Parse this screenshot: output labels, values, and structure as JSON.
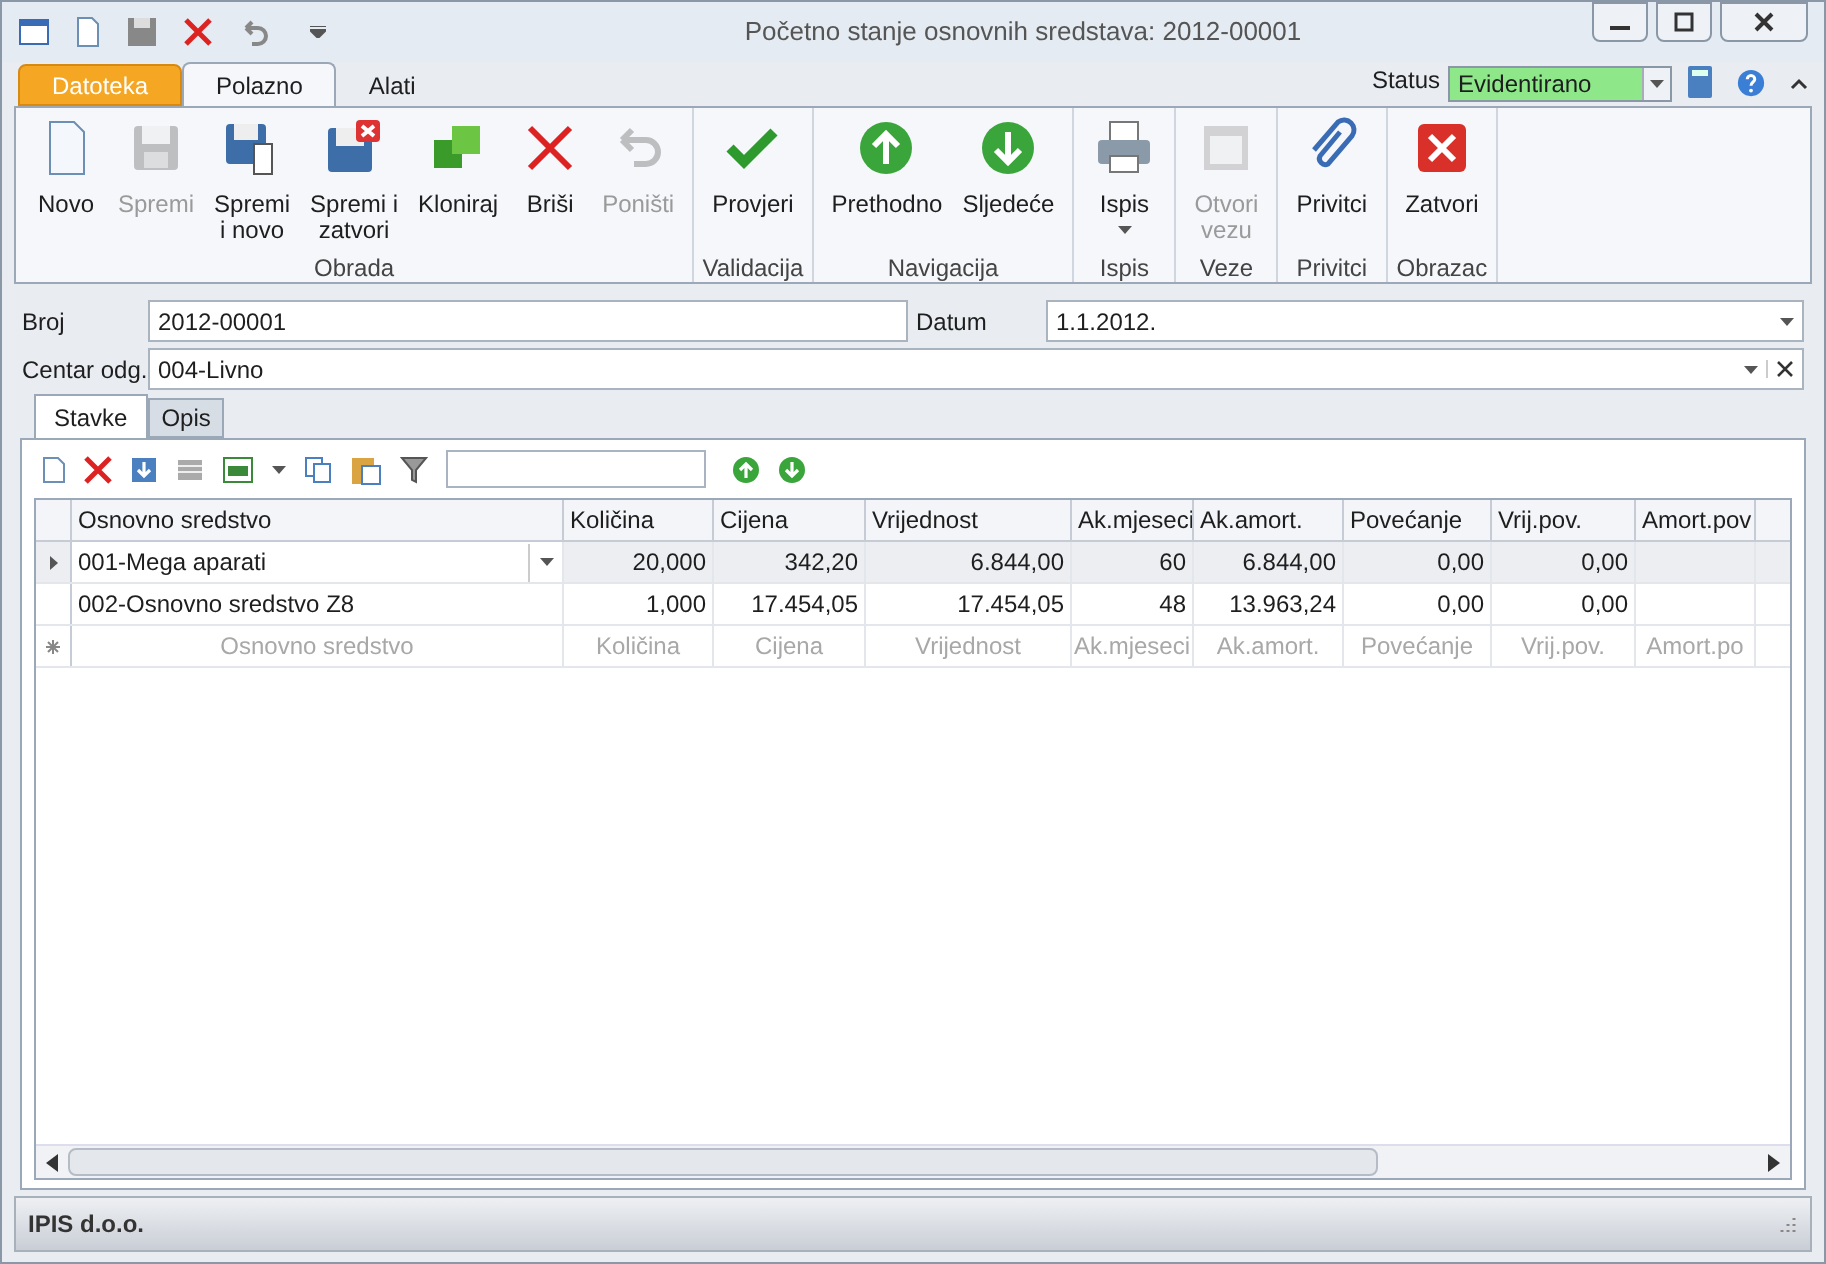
{
  "window": {
    "title": "Početno stanje osnovnih sredstava: 2012-00001"
  },
  "ribbon_tabs": [
    {
      "label": "Datoteka",
      "kind": "file",
      "selected": false
    },
    {
      "label": "Polazno",
      "kind": "tab",
      "selected": true
    },
    {
      "label": "Alati",
      "kind": "tab",
      "selected": false
    }
  ],
  "status": {
    "label": "Status",
    "value": "Evidentirano"
  },
  "ribbon_groups": [
    {
      "label": "Obrada",
      "buttons": [
        {
          "label": "Novo",
          "disabled": false
        },
        {
          "label": "Spremi",
          "disabled": true
        },
        {
          "label": "Spremi\ni novo",
          "disabled": false
        },
        {
          "label": "Spremi i\nzatvori",
          "disabled": false
        },
        {
          "label": "Kloniraj",
          "disabled": false
        },
        {
          "label": "Briši",
          "disabled": false
        },
        {
          "label": "Poništi",
          "disabled": true
        }
      ]
    },
    {
      "label": "Validacija",
      "buttons": [
        {
          "label": "Provjeri",
          "disabled": false
        }
      ]
    },
    {
      "label": "Navigacija",
      "buttons": [
        {
          "label": "Prethodno",
          "disabled": false
        },
        {
          "label": "Sljedeće",
          "disabled": false
        }
      ]
    },
    {
      "label": "Ispis",
      "buttons": [
        {
          "label": "Ispis",
          "disabled": false
        }
      ]
    },
    {
      "label": "Veze",
      "buttons": [
        {
          "label": "Otvori\nvezu",
          "disabled": true
        }
      ]
    },
    {
      "label": "Privitci",
      "buttons": [
        {
          "label": "Privitci",
          "disabled": false
        }
      ]
    },
    {
      "label": "Obrazac",
      "buttons": [
        {
          "label": "Zatvori",
          "disabled": false
        }
      ]
    }
  ],
  "form": {
    "broj_label": "Broj",
    "broj": "2012-00001",
    "datum_label": "Datum",
    "datum": "1.1.2012.",
    "centar_label": "Centar odg.",
    "centar": "004-Livno"
  },
  "tabs": [
    {
      "label": "Stavke",
      "selected": true
    },
    {
      "label": "Opis",
      "selected": false
    }
  ],
  "table": {
    "columns": [
      "Osnovno sredstvo",
      "Količina",
      "Cijena",
      "Vrijednost",
      "Ak.mjeseci",
      "Ak.amort.",
      "Povećanje",
      "Vrij.pov.",
      "Amort.pov"
    ],
    "rows": [
      {
        "selected": true,
        "cells": [
          "001-Mega aparati",
          "20,000",
          "342,20",
          "6.844,00",
          "60",
          "6.844,00",
          "0,00",
          "0,00"
        ]
      },
      {
        "selected": false,
        "cells": [
          "002-Osnovno sredstvo Z8",
          "1,000",
          "17.454,05",
          "17.454,05",
          "48",
          "13.963,24",
          "0,00",
          "0,00"
        ]
      }
    ],
    "new_row": [
      "Osnovno sredstvo",
      "Količina",
      "Cijena",
      "Vrijednost",
      "Ak.mjeseci",
      "Ak.amort.",
      "Povećanje",
      "Vrij.pov.",
      "Amort.po"
    ]
  },
  "status_bar": {
    "company": "IPIS d.o.o."
  }
}
